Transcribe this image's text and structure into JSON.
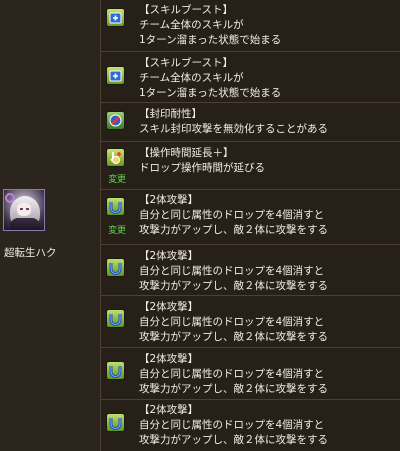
{
  "monster": {
    "name": "超転生ハク"
  },
  "awakenings": [
    {
      "icon": "skill-boost-icon",
      "changed": false,
      "lines": [
        "【スキルブースト】",
        "チーム全体のスキルが",
        "1ターン溜まった状態で始まる"
      ]
    },
    {
      "icon": "skill-boost-icon",
      "changed": false,
      "lines": [
        "【スキルブースト】",
        "チーム全体のスキルが",
        "1ターン溜まった状態で始まる"
      ]
    },
    {
      "icon": "seal-resist-icon",
      "changed": false,
      "lines": [
        "【封印耐性】",
        "スキル封印攻撃を無効化することがある"
      ]
    },
    {
      "icon": "time-extend-plus-icon",
      "changed": true,
      "lines": [
        "【操作時間延長＋】",
        "ドロップ操作時間が延びる"
      ]
    },
    {
      "icon": "two-pronged-attack-icon",
      "changed": true,
      "lines": [
        "【2体攻撃】",
        "自分と同じ属性のドロップを4個消すと",
        "攻撃力がアップし、敵２体に攻撃をする"
      ]
    },
    {
      "icon": "two-pronged-attack-icon",
      "changed": false,
      "lines": [
        "【2体攻撃】",
        "自分と同じ属性のドロップを4個消すと",
        "攻撃力がアップし、敵２体に攻撃をする"
      ]
    },
    {
      "icon": "two-pronged-attack-icon",
      "changed": false,
      "lines": [
        "【2体攻撃】",
        "自分と同じ属性のドロップを4個消すと",
        "攻撃力がアップし、敵２体に攻撃をする"
      ]
    },
    {
      "icon": "two-pronged-attack-icon",
      "changed": false,
      "lines": [
        "【2体攻撃】",
        "自分と同じ属性のドロップを4個消すと",
        "攻撃力がアップし、敵２体に攻撃をする"
      ]
    },
    {
      "icon": "two-pronged-attack-icon",
      "changed": false,
      "lines": [
        "【2体攻撃】",
        "自分と同じ属性のドロップを4個消すと",
        "攻撃力がアップし、敵２体に攻撃をする"
      ]
    }
  ],
  "labels": {
    "changed": "変更"
  },
  "colors": {
    "changed_label": "#5fd24b",
    "text": "#f2ede4",
    "background": "#241e17"
  }
}
